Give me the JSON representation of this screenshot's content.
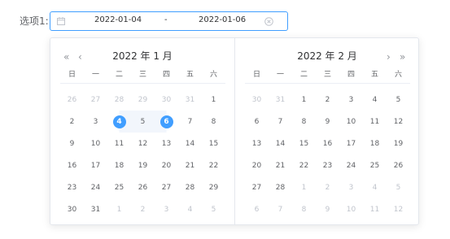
{
  "field": {
    "label": "选项1:",
    "start_value": "2022-01-04",
    "separator": "-",
    "end_value": "2022-01-06"
  },
  "colors": {
    "accent": "#409eff",
    "range_bg": "#f2f6fc",
    "muted": "#c0c4cc"
  },
  "icons": {
    "calendar": "calendar-icon",
    "clear": "circle-close-icon",
    "prev_year": "double-chevron-left-icon",
    "prev_month": "chevron-left-icon",
    "next_month": "chevron-right-icon",
    "next_year": "double-chevron-right-icon"
  },
  "picker": {
    "weekdays": [
      "日",
      "一",
      "二",
      "三",
      "四",
      "五",
      "六"
    ],
    "nav": {
      "prev_year": "«",
      "prev_month": "‹",
      "next_month": "›",
      "next_year": "»"
    },
    "left": {
      "title": "2022 年 1 月",
      "days": [
        {
          "d": "26",
          "out": true
        },
        {
          "d": "27",
          "out": true
        },
        {
          "d": "28",
          "out": true
        },
        {
          "d": "29",
          "out": true
        },
        {
          "d": "30",
          "out": true
        },
        {
          "d": "31",
          "out": true
        },
        {
          "d": "1"
        },
        {
          "d": "2"
        },
        {
          "d": "3"
        },
        {
          "d": "4",
          "selected": "start"
        },
        {
          "d": "5",
          "range": true
        },
        {
          "d": "6",
          "selected": "end"
        },
        {
          "d": "7"
        },
        {
          "d": "8"
        },
        {
          "d": "9"
        },
        {
          "d": "10"
        },
        {
          "d": "11"
        },
        {
          "d": "12"
        },
        {
          "d": "13"
        },
        {
          "d": "14"
        },
        {
          "d": "15"
        },
        {
          "d": "16"
        },
        {
          "d": "17"
        },
        {
          "d": "18"
        },
        {
          "d": "19"
        },
        {
          "d": "20"
        },
        {
          "d": "21"
        },
        {
          "d": "22"
        },
        {
          "d": "23"
        },
        {
          "d": "24"
        },
        {
          "d": "25"
        },
        {
          "d": "26"
        },
        {
          "d": "27"
        },
        {
          "d": "28"
        },
        {
          "d": "29"
        },
        {
          "d": "30"
        },
        {
          "d": "31"
        },
        {
          "d": "1",
          "out": true
        },
        {
          "d": "2",
          "out": true
        },
        {
          "d": "3",
          "out": true
        },
        {
          "d": "4",
          "out": true
        },
        {
          "d": "5",
          "out": true
        }
      ]
    },
    "right": {
      "title": "2022 年 2 月",
      "days": [
        {
          "d": "30",
          "out": true
        },
        {
          "d": "31",
          "out": true
        },
        {
          "d": "1"
        },
        {
          "d": "2"
        },
        {
          "d": "3"
        },
        {
          "d": "4"
        },
        {
          "d": "5"
        },
        {
          "d": "6"
        },
        {
          "d": "7"
        },
        {
          "d": "8"
        },
        {
          "d": "9"
        },
        {
          "d": "10"
        },
        {
          "d": "11"
        },
        {
          "d": "12"
        },
        {
          "d": "13"
        },
        {
          "d": "14"
        },
        {
          "d": "15"
        },
        {
          "d": "16"
        },
        {
          "d": "17"
        },
        {
          "d": "18"
        },
        {
          "d": "19"
        },
        {
          "d": "20"
        },
        {
          "d": "21"
        },
        {
          "d": "22"
        },
        {
          "d": "23"
        },
        {
          "d": "24"
        },
        {
          "d": "25"
        },
        {
          "d": "26"
        },
        {
          "d": "27"
        },
        {
          "d": "28"
        },
        {
          "d": "1",
          "out": true
        },
        {
          "d": "2",
          "out": true
        },
        {
          "d": "3",
          "out": true
        },
        {
          "d": "4",
          "out": true
        },
        {
          "d": "5",
          "out": true
        },
        {
          "d": "6",
          "out": true
        },
        {
          "d": "7",
          "out": true
        },
        {
          "d": "8",
          "out": true
        },
        {
          "d": "9",
          "out": true
        },
        {
          "d": "10",
          "out": true
        },
        {
          "d": "11",
          "out": true
        },
        {
          "d": "12",
          "out": true
        }
      ]
    }
  }
}
